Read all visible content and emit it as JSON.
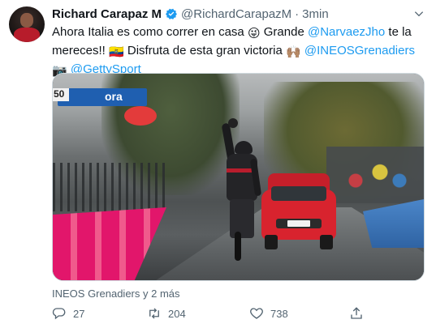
{
  "tweet": {
    "name": "Richard Carapaz M",
    "handle": "@RichardCarapazM",
    "dot": "·",
    "time": "3min",
    "text": {
      "t1": "Ahora Italia es como correr en casa ",
      "e1": "😜",
      "t2": " Grande ",
      "m1": "@NarvaezJho",
      "t3": " te la mereces!! ",
      "e2": "🇪🇨",
      "t4": " Disfruta de esta gran victoria ",
      "e3": "🙌🏽",
      "t5": " ",
      "m2": "@INEOSGrenadiers",
      "t6": " ",
      "e4": "📷",
      "t7": " ",
      "m3": "@GettySport"
    },
    "photo_overlay": {
      "banner_text": "ora",
      "distance": "50"
    },
    "tagged": "INEOS Grenadiers y 2 más",
    "stats": {
      "replies": "27",
      "retweets": "204",
      "likes": "738"
    }
  },
  "icons": {
    "verified": "verified-badge-icon",
    "caret": "chevron-down-icon",
    "reply": "reply-icon",
    "retweet": "retweet-icon",
    "like": "heart-icon",
    "share": "share-icon"
  },
  "colors": {
    "link": "#1d9bf0",
    "muted": "#536471",
    "text": "#0f1419"
  }
}
